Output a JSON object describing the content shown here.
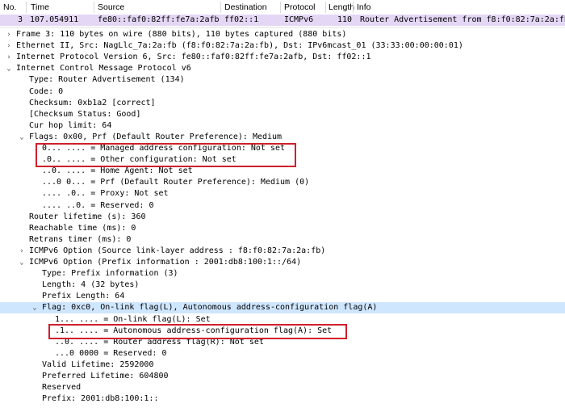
{
  "columns": {
    "no": "No.",
    "time": "Time",
    "source": "Source",
    "destination": "Destination",
    "protocol": "Protocol",
    "length": "Length",
    "info": "Info"
  },
  "packet": {
    "no": "3",
    "time": "107.054911",
    "source": "fe80::faf0:82ff:fe7a:2afb",
    "destination": "ff02::1",
    "protocol": "ICMPv6",
    "length": "110",
    "info": "Router Advertisement from f8:f0:82:7a:2a:fb"
  },
  "tree": [
    {
      "text": "Frame 3: 110 bytes on wire (880 bits), 110 bytes captured (880 bits)",
      "arrow": "›"
    },
    {
      "text": "Ethernet II, Src: NagLlc_7a:2a:fb (f8:f0:82:7a:2a:fb), Dst: IPv6mcast_01 (33:33:00:00:00:01)",
      "arrow": "›"
    },
    {
      "text": "Internet Protocol Version 6, Src: fe80::faf0:82ff:fe7a:2afb, Dst: ff02::1",
      "arrow": "›"
    },
    {
      "text": "Internet Control Message Protocol v6",
      "arrow": "⌄"
    },
    {
      "text": "Type: Router Advertisement (134)",
      "arrow": ""
    },
    {
      "text": "Code: 0",
      "arrow": ""
    },
    {
      "text": "Checksum: 0xb1a2 [correct]",
      "arrow": ""
    },
    {
      "text": "[Checksum Status: Good]",
      "arrow": ""
    },
    {
      "text": "Cur hop limit: 64",
      "arrow": ""
    },
    {
      "text": "Flags: 0x00, Prf (Default Router Preference): Medium",
      "arrow": "⌄"
    },
    {
      "text": "0... .... = Managed address configuration: Not set",
      "arrow": ""
    },
    {
      "text": ".0.. .... = Other configuration: Not set",
      "arrow": ""
    },
    {
      "text": "..0. .... = Home Agent: Not set",
      "arrow": ""
    },
    {
      "text": "...0 0... = Prf (Default Router Preference): Medium (0)",
      "arrow": ""
    },
    {
      "text": ".... .0.. = Proxy: Not set",
      "arrow": ""
    },
    {
      "text": ".... ..0. = Reserved: 0",
      "arrow": ""
    },
    {
      "text": "Router lifetime (s): 360",
      "arrow": ""
    },
    {
      "text": "Reachable time (ms): 0",
      "arrow": ""
    },
    {
      "text": "Retrans timer (ms): 0",
      "arrow": ""
    },
    {
      "text": "ICMPv6 Option (Source link-layer address : f8:f0:82:7a:2a:fb)",
      "arrow": "›"
    },
    {
      "text": "ICMPv6 Option (Prefix information : 2001:db8:100:1::/64)",
      "arrow": "⌄"
    },
    {
      "text": "Type: Prefix information (3)",
      "arrow": ""
    },
    {
      "text": "Length: 4 (32 bytes)",
      "arrow": ""
    },
    {
      "text": "Prefix Length: 64",
      "arrow": ""
    },
    {
      "text": "Flag: 0xc0, On-link flag(L), Autonomous address-configuration flag(A)",
      "arrow": "⌄"
    },
    {
      "text": "1... .... = On-link flag(L): Set",
      "arrow": ""
    },
    {
      "text": ".1.. .... = Autonomous address-configuration flag(A): Set",
      "arrow": ""
    },
    {
      "text": "..0. .... = Router address flag(R): Not set",
      "arrow": ""
    },
    {
      "text": "...0 0000 = Reserved: 0",
      "arrow": ""
    },
    {
      "text": "Valid Lifetime: 2592000",
      "arrow": ""
    },
    {
      "text": "Preferred Lifetime: 604800",
      "arrow": ""
    },
    {
      "text": "Reserved",
      "arrow": ""
    },
    {
      "text": "Prefix: 2001:db8:100:1::",
      "arrow": ""
    }
  ],
  "colors": {
    "selected_row": "#cfe6ff",
    "packet_row": "#e4d7f5",
    "highlight_box": "#d0202c"
  }
}
